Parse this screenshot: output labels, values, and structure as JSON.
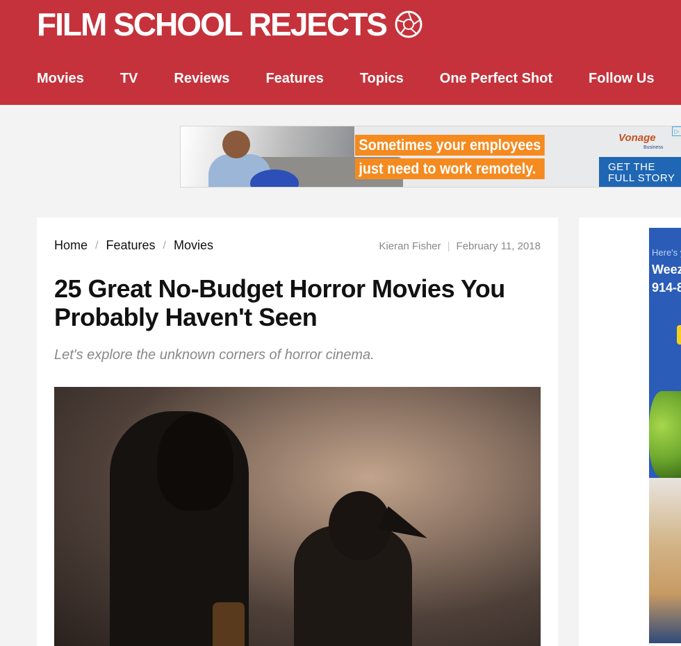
{
  "header": {
    "logo_text": "FILM SCHOOL REJECTS",
    "nav": [
      "Movies",
      "TV",
      "Reviews",
      "Features",
      "Topics",
      "One Perfect Shot",
      "Follow Us"
    ]
  },
  "top_ad": {
    "headline_line1": "Sometimes your employees",
    "headline_line2": "just need to work remotely.",
    "brand": "Vonage",
    "brand_sub": "Business",
    "cta_line1": "GET THE",
    "cta_line2": "FULL STORY"
  },
  "article": {
    "breadcrumb": [
      "Home",
      "Features",
      "Movies"
    ],
    "author": "Kieran Fisher",
    "date": "February 11, 2018",
    "title": "25 Great No-Budget Horror Movies You Probably Haven't Seen",
    "dek": "Let's explore the unknown corners of horror cinema."
  },
  "side_ad": {
    "line1": "Here's y",
    "line2": "Weez",
    "line3": "914-8"
  },
  "colors": {
    "brand_red": "#c5323b",
    "ad_orange": "#f58a1f",
    "ad_blue": "#1f67b4"
  }
}
